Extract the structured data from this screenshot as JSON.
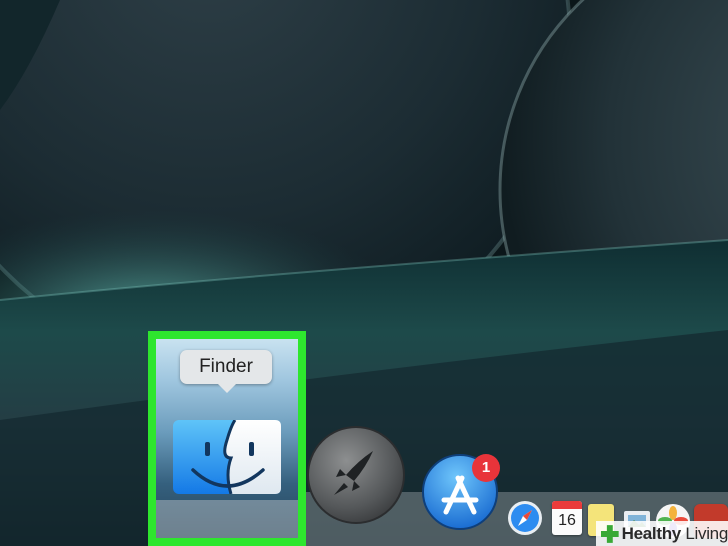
{
  "tooltip": {
    "label": "Finder"
  },
  "dock": {
    "items": [
      {
        "name": "Finder",
        "icon": "finder-icon",
        "highlighted": true
      },
      {
        "icon": "launchpad-icon"
      },
      {
        "icon": "app-store-icon",
        "badge": "1"
      },
      {
        "icon": "safari-icon"
      },
      {
        "icon": "calendar-icon",
        "day": "16"
      },
      {
        "icon": "notes-icon"
      },
      {
        "icon": "preview-icon"
      },
      {
        "icon": "photos-icon"
      },
      {
        "icon": "app-icon"
      }
    ]
  },
  "watermark": {
    "brand": "Healthy",
    "suffix": " Living"
  },
  "colors": {
    "highlight": "#2ee62e",
    "badge": "#e8343a",
    "finder_blue": "#1a8cf0",
    "watermark_green": "#39a935"
  }
}
